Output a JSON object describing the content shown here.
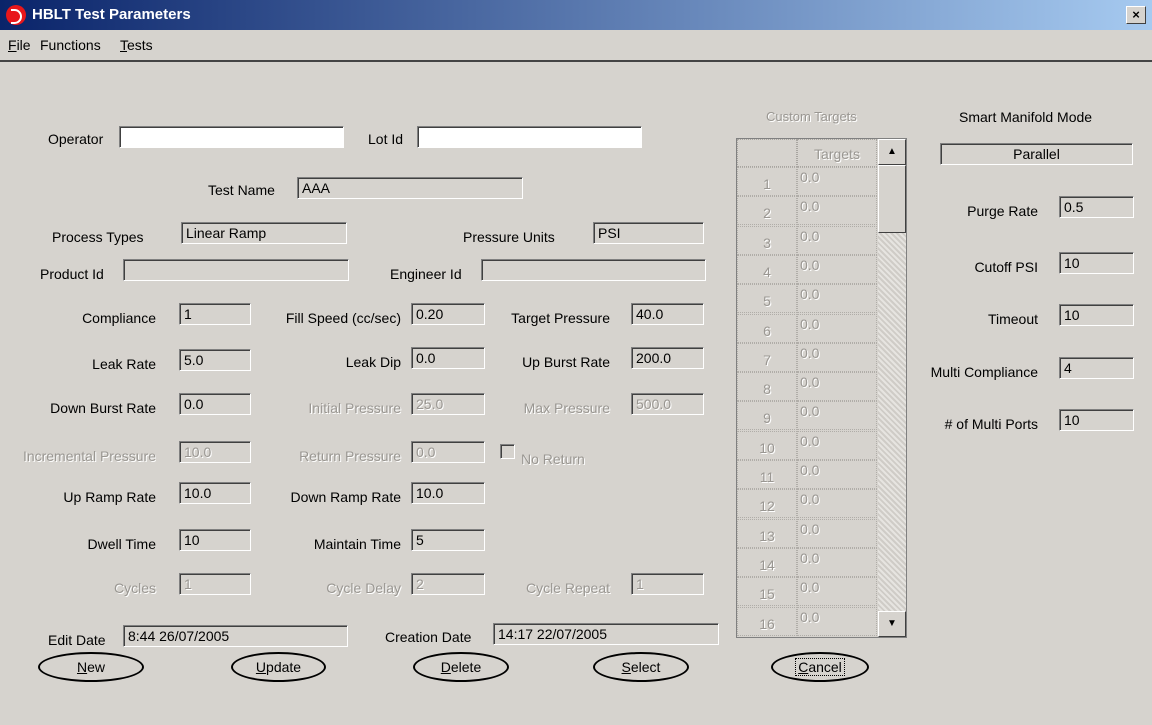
{
  "window": {
    "title": "HBLT Test Parameters",
    "close_glyph": "×"
  },
  "menu": [
    {
      "mn": "F",
      "rest": "ile"
    },
    {
      "pre": "Functions",
      "rest": ""
    },
    {
      "mn": "T",
      "rest": "ests"
    }
  ],
  "form": {
    "operator": {
      "label": "Operator",
      "value": ""
    },
    "lot_id": {
      "label": "Lot Id",
      "value": ""
    },
    "test_name": {
      "label": "Test Name",
      "value": "AAA"
    },
    "process_types": {
      "label": "Process Types",
      "value": "Linear Ramp"
    },
    "pressure_units": {
      "label": "Pressure Units",
      "value": "PSI"
    },
    "product_id": {
      "label": "Product Id",
      "value": ""
    },
    "engineer_id": {
      "label": "Engineer Id",
      "value": ""
    },
    "compliance": {
      "label": "Compliance",
      "value": "1"
    },
    "fill_speed": {
      "label": "Fill Speed (cc/sec)",
      "value": "0.20"
    },
    "target_pressure": {
      "label": "Target Pressure",
      "value": "40.0"
    },
    "leak_rate": {
      "label": "Leak Rate",
      "value": "5.0"
    },
    "leak_dip": {
      "label": "Leak Dip",
      "value": "0.0"
    },
    "up_burst_rate": {
      "label": "Up Burst Rate",
      "value": "200.0"
    },
    "down_burst_rate": {
      "label": "Down Burst Rate",
      "value": "0.0"
    },
    "initial_pressure": {
      "label": "Initial Pressure",
      "value": "25.0"
    },
    "max_pressure": {
      "label": "Max Pressure",
      "value": "500.0"
    },
    "incremental_pressure": {
      "label": "Incremental Pressure",
      "value": "10.0"
    },
    "return_pressure": {
      "label": "Return Pressure",
      "value": "0.0"
    },
    "no_return": {
      "label": "No Return"
    },
    "up_ramp_rate": {
      "label": "Up Ramp Rate",
      "value": "10.0"
    },
    "down_ramp_rate": {
      "label": "Down Ramp Rate",
      "value": "10.0"
    },
    "dwell_time": {
      "label": "Dwell Time",
      "value": "10"
    },
    "maintain_time": {
      "label": "Maintain Time",
      "value": "5"
    },
    "cycles": {
      "label": "Cycles",
      "value": "1"
    },
    "cycle_delay": {
      "label": "Cycle Delay",
      "value": "2"
    },
    "cycle_repeat": {
      "label": "Cycle Repeat",
      "value": "1"
    },
    "edit_date": {
      "label": "Edit Date",
      "value": "8:44  26/07/2005"
    },
    "creation_date": {
      "label": "Creation Date",
      "value": "14:17  22/07/2005"
    }
  },
  "custom_targets": {
    "title": "Custom Targets",
    "header": "Targets",
    "rows": [
      {
        "n": "1",
        "v": "0.0"
      },
      {
        "n": "2",
        "v": "0.0"
      },
      {
        "n": "3",
        "v": "0.0"
      },
      {
        "n": "4",
        "v": "0.0"
      },
      {
        "n": "5",
        "v": "0.0"
      },
      {
        "n": "6",
        "v": "0.0"
      },
      {
        "n": "7",
        "v": "0.0"
      },
      {
        "n": "8",
        "v": "0.0"
      },
      {
        "n": "9",
        "v": "0.0"
      },
      {
        "n": "10",
        "v": "0.0"
      },
      {
        "n": "11",
        "v": "0.0"
      },
      {
        "n": "12",
        "v": "0.0"
      },
      {
        "n": "13",
        "v": "0.0"
      },
      {
        "n": "14",
        "v": "0.0"
      },
      {
        "n": "15",
        "v": "0.0"
      },
      {
        "n": "16",
        "v": "0.0"
      }
    ]
  },
  "manifold": {
    "title": "Smart Manifold Mode",
    "mode": "Parallel",
    "purge_rate": {
      "label": "Purge Rate",
      "value": "0.5"
    },
    "cutoff_psi": {
      "label": "Cutoff PSI",
      "value": "10"
    },
    "timeout": {
      "label": "Timeout",
      "value": "10"
    },
    "multi_compliance": {
      "label": "Multi Compliance",
      "value": "4"
    },
    "multi_ports": {
      "label": "# of Multi Ports",
      "value": "10"
    }
  },
  "buttons": {
    "new": {
      "mn": "N",
      "rest": "ew"
    },
    "update": {
      "mn": "U",
      "rest": "pdate"
    },
    "delete": {
      "mn": "D",
      "rest": "elete"
    },
    "select": {
      "mn": "S",
      "rest": "elect"
    },
    "cancel": {
      "mn": "C",
      "rest": "ancel"
    }
  }
}
